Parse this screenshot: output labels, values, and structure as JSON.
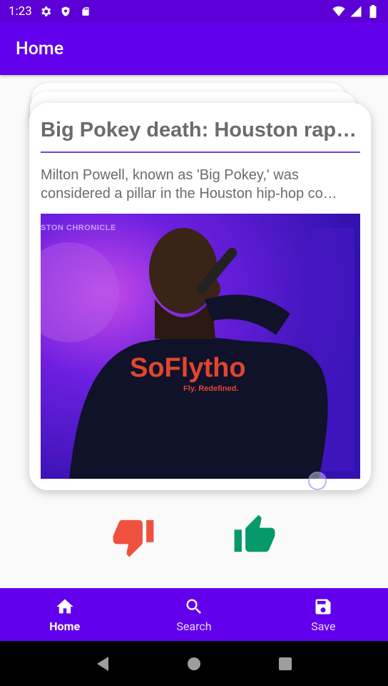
{
  "status_bar": {
    "time": "1:23",
    "icons": [
      "gear-icon",
      "shield-icon",
      "sd-card-icon",
      "wifi-icon",
      "signal-icon",
      "battery-icon"
    ]
  },
  "app_bar": {
    "title": "Home"
  },
  "article": {
    "title": "Big Pokey death: Houston rap…",
    "description": "Milton Powell, known as 'Big Pokey,' was considered a pillar in the Houston hip-hop co…",
    "image": {
      "watermark": "STON CHRONICLE",
      "shirt_text": "SoFlytho",
      "shirt_subtext": "Fly. Redefined."
    }
  },
  "actions": {
    "dislike_icon": "thumbs-down-icon",
    "like_icon": "thumbs-up-icon",
    "dislike_color": "#f0513f",
    "like_color": "#06996b"
  },
  "bottom_nav": {
    "items": [
      {
        "label": "Home",
        "icon": "home-icon",
        "active": true
      },
      {
        "label": "Search",
        "icon": "search-icon",
        "active": false
      },
      {
        "label": "Save",
        "icon": "save-icon",
        "active": false
      }
    ]
  },
  "colors": {
    "primary": "#6200ee",
    "status_bar": "#5d00d8",
    "divider": "#7a3fe0"
  }
}
